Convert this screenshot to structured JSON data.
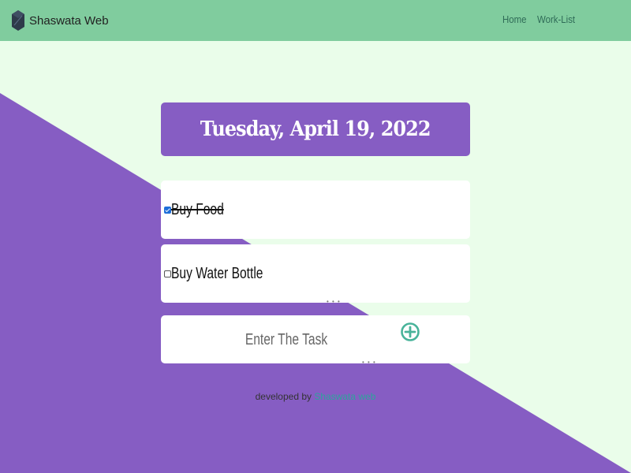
{
  "navbar": {
    "brand": "Shaswata Web",
    "links": [
      "Home",
      "Work-List"
    ]
  },
  "header": {
    "date": "Tuesday, April 19, 2022"
  },
  "items": [
    {
      "label": "Buy Food",
      "checked": true
    },
    {
      "label": "Buy Water Bottle",
      "checked": false
    }
  ],
  "new_task": {
    "placeholder": "Enter The Task",
    "value": ""
  },
  "footer": {
    "prefix": "developed by",
    "link": "Shaswata web"
  },
  "colors": {
    "navbar": "#80CC9E",
    "background": "#EAFDEA",
    "purple": "#865DC3",
    "accent": "#48B39A"
  },
  "icons": {
    "brand": "hexagon-logo-icon",
    "add": "plus-circle-icon"
  }
}
